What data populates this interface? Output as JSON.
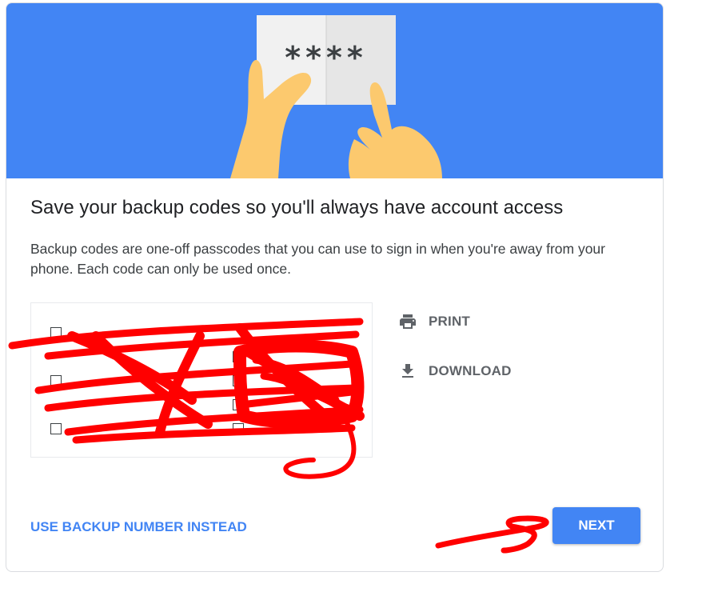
{
  "banner": {
    "code_text": "****",
    "colors": {
      "background": "#4285f4",
      "skin": "#fcc96e",
      "paper": "#f1f1f1"
    }
  },
  "page": {
    "title": "Save your backup codes so you'll always have account access",
    "description": "Backup codes are one-off passcodes that you can use to sign in when you're away from your phone. Each code can only be used once."
  },
  "codes": {
    "items": [
      "",
      "",
      "",
      "",
      "",
      "",
      "",
      ""
    ],
    "redacted": true
  },
  "actions": {
    "print": {
      "label": "PRINT",
      "icon": "printer-icon"
    },
    "download": {
      "label": "DOWNLOAD",
      "icon": "download-icon"
    }
  },
  "footer": {
    "alt_link_label": "USE BACKUP NUMBER INSTEAD",
    "next_label": "NEXT"
  },
  "colors": {
    "accent": "#4285f4",
    "annotation": "#ff0000",
    "text": "#202124"
  }
}
